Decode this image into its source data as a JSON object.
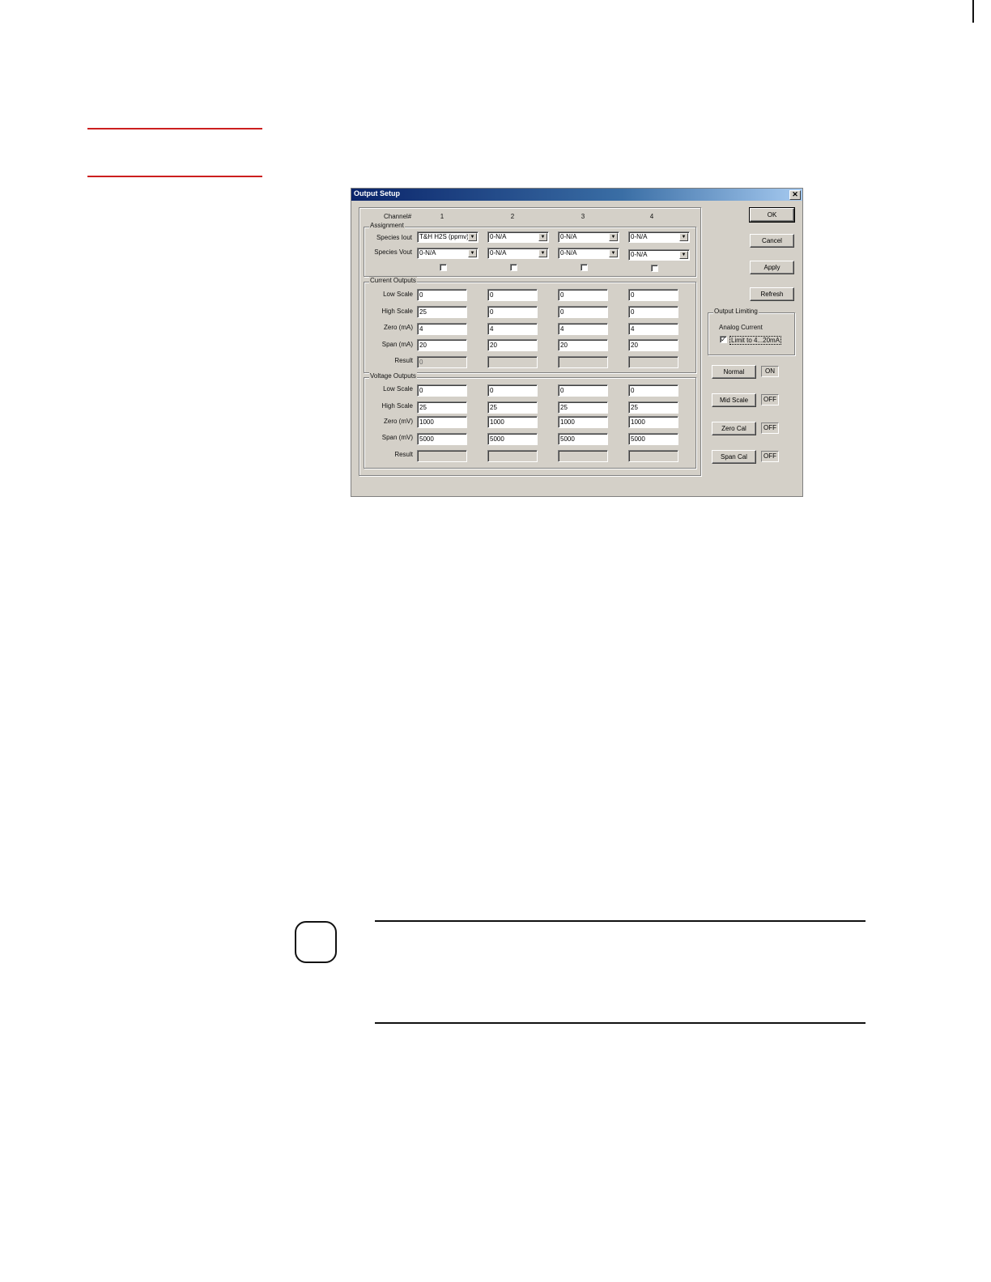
{
  "dialog": {
    "title": "Output Setup",
    "close_icon": "close-x-icon",
    "channel_header": "Channel#",
    "channels": [
      "1",
      "2",
      "3",
      "4"
    ],
    "assignment": {
      "title": "Assignment",
      "species_iout_label": "Species Iout",
      "species_vout_label": "Species Vout",
      "species_iout": [
        "T&H H2S (ppmv)",
        "0-N/A",
        "0-N/A",
        "0-N/A"
      ],
      "species_vout": [
        "0-N/A",
        "0-N/A",
        "0-N/A",
        "0-N/A"
      ],
      "checkbox_checked": [
        false,
        false,
        false,
        false
      ]
    },
    "current_outputs": {
      "title": "Current Outputs",
      "low_scale_label": "Low Scale",
      "high_scale_label": "High Scale",
      "zero_label": "Zero (mA)",
      "span_label": "Span (mA)",
      "result_label": "Result",
      "low_scale": [
        "0",
        "0",
        "0",
        "0"
      ],
      "high_scale": [
        "25",
        "0",
        "0",
        "0"
      ],
      "zero": [
        "4",
        "4",
        "4",
        "4"
      ],
      "span": [
        "20",
        "20",
        "20",
        "20"
      ],
      "result": [
        "0",
        "",
        "",
        ""
      ]
    },
    "voltage_outputs": {
      "title": "Voltage Outputs",
      "low_scale_label": "Low Scale",
      "high_scale_label": "High Scale",
      "zero_label": "Zero (mV)",
      "span_label": "Span (mV)",
      "result_label": "Result",
      "low_scale": [
        "0",
        "0",
        "0",
        "0"
      ],
      "high_scale": [
        "25",
        "25",
        "25",
        "25"
      ],
      "zero": [
        "1000",
        "1000",
        "1000",
        "1000"
      ],
      "span": [
        "5000",
        "5000",
        "5000",
        "5000"
      ],
      "result": [
        "",
        "",
        "",
        ""
      ]
    },
    "buttons": {
      "ok": "OK",
      "cancel": "Cancel",
      "apply": "Apply",
      "refresh": "Refresh"
    },
    "output_limiting": {
      "title": "Output Limiting",
      "analog_current_label": "Analog Current",
      "limit_label": "Limit to 4...20mA",
      "limit_checked": true
    },
    "modes": [
      {
        "label": "Normal",
        "state": "ON"
      },
      {
        "label": "Mid Scale",
        "state": "OFF"
      },
      {
        "label": "Zero Cal",
        "state": "OFF"
      },
      {
        "label": "Span Cal",
        "state": "OFF"
      }
    ]
  },
  "colors": {
    "rule_red": "#cc1f1f",
    "dialog_face": "#d4d0c8",
    "titlebar": "#0a246a"
  }
}
